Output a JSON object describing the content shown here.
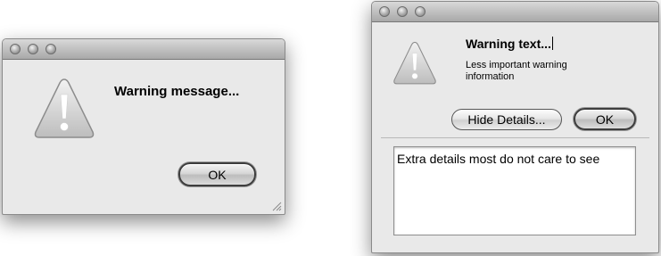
{
  "dialog_simple": {
    "message": "Warning message...",
    "ok_label": "OK",
    "icon": "warning-icon"
  },
  "dialog_details": {
    "message": "Warning text...",
    "informative": "Less important warning information",
    "hide_details_label": "Hide Details...",
    "ok_label": "OK",
    "details_text": "Extra details most do not care to see",
    "icon": "warning-icon"
  },
  "colors": {
    "window_bg": "#e9e9e9",
    "titlebar": "#b8b8b8"
  }
}
